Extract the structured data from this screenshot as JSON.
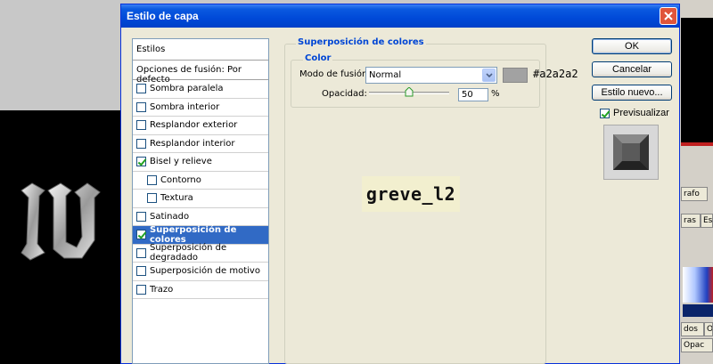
{
  "background": {
    "right_tabs": [
      "rafo",
      "ras",
      "Es",
      "dos",
      "O",
      "Opac"
    ]
  },
  "dialog": {
    "title": "Estilo de capa",
    "styles_panel": {
      "header": "Estilos",
      "blend_options": "Opciones de fusión: Por defecto",
      "items": [
        {
          "label": "Sombra paralela",
          "checked": false,
          "indent": false,
          "selected": false
        },
        {
          "label": "Sombra interior",
          "checked": false,
          "indent": false,
          "selected": false
        },
        {
          "label": "Resplandor exterior",
          "checked": false,
          "indent": false,
          "selected": false
        },
        {
          "label": "Resplandor interior",
          "checked": false,
          "indent": false,
          "selected": false
        },
        {
          "label": "Bisel y relieve",
          "checked": true,
          "indent": false,
          "selected": false
        },
        {
          "label": "Contorno",
          "checked": false,
          "indent": true,
          "selected": false
        },
        {
          "label": "Textura",
          "checked": false,
          "indent": true,
          "selected": false
        },
        {
          "label": "Satinado",
          "checked": false,
          "indent": false,
          "selected": false
        },
        {
          "label": "Superposición de colores",
          "checked": true,
          "indent": false,
          "selected": true
        },
        {
          "label": "Superposición de degradado",
          "checked": false,
          "indent": false,
          "selected": false
        },
        {
          "label": "Superposición de motivo",
          "checked": false,
          "indent": false,
          "selected": false
        },
        {
          "label": "Trazo",
          "checked": false,
          "indent": false,
          "selected": false
        }
      ]
    },
    "main": {
      "group_title": "Superposición de colores",
      "subgroup_title": "Color",
      "blend_mode_label": "Modo de fusión:",
      "blend_mode_value": "Normal",
      "color_hex": "#a2a2a2",
      "color_label": "#a2a2a2",
      "opacity_label": "Opacidad:",
      "opacity_value": "50",
      "opacity_unit": "%",
      "watermark": "greve_l2"
    },
    "buttons": {
      "ok": "OK",
      "cancel": "Cancelar",
      "new_style": "Estilo nuevo...",
      "preview_label": "Previsualizar",
      "preview_checked": true
    }
  }
}
